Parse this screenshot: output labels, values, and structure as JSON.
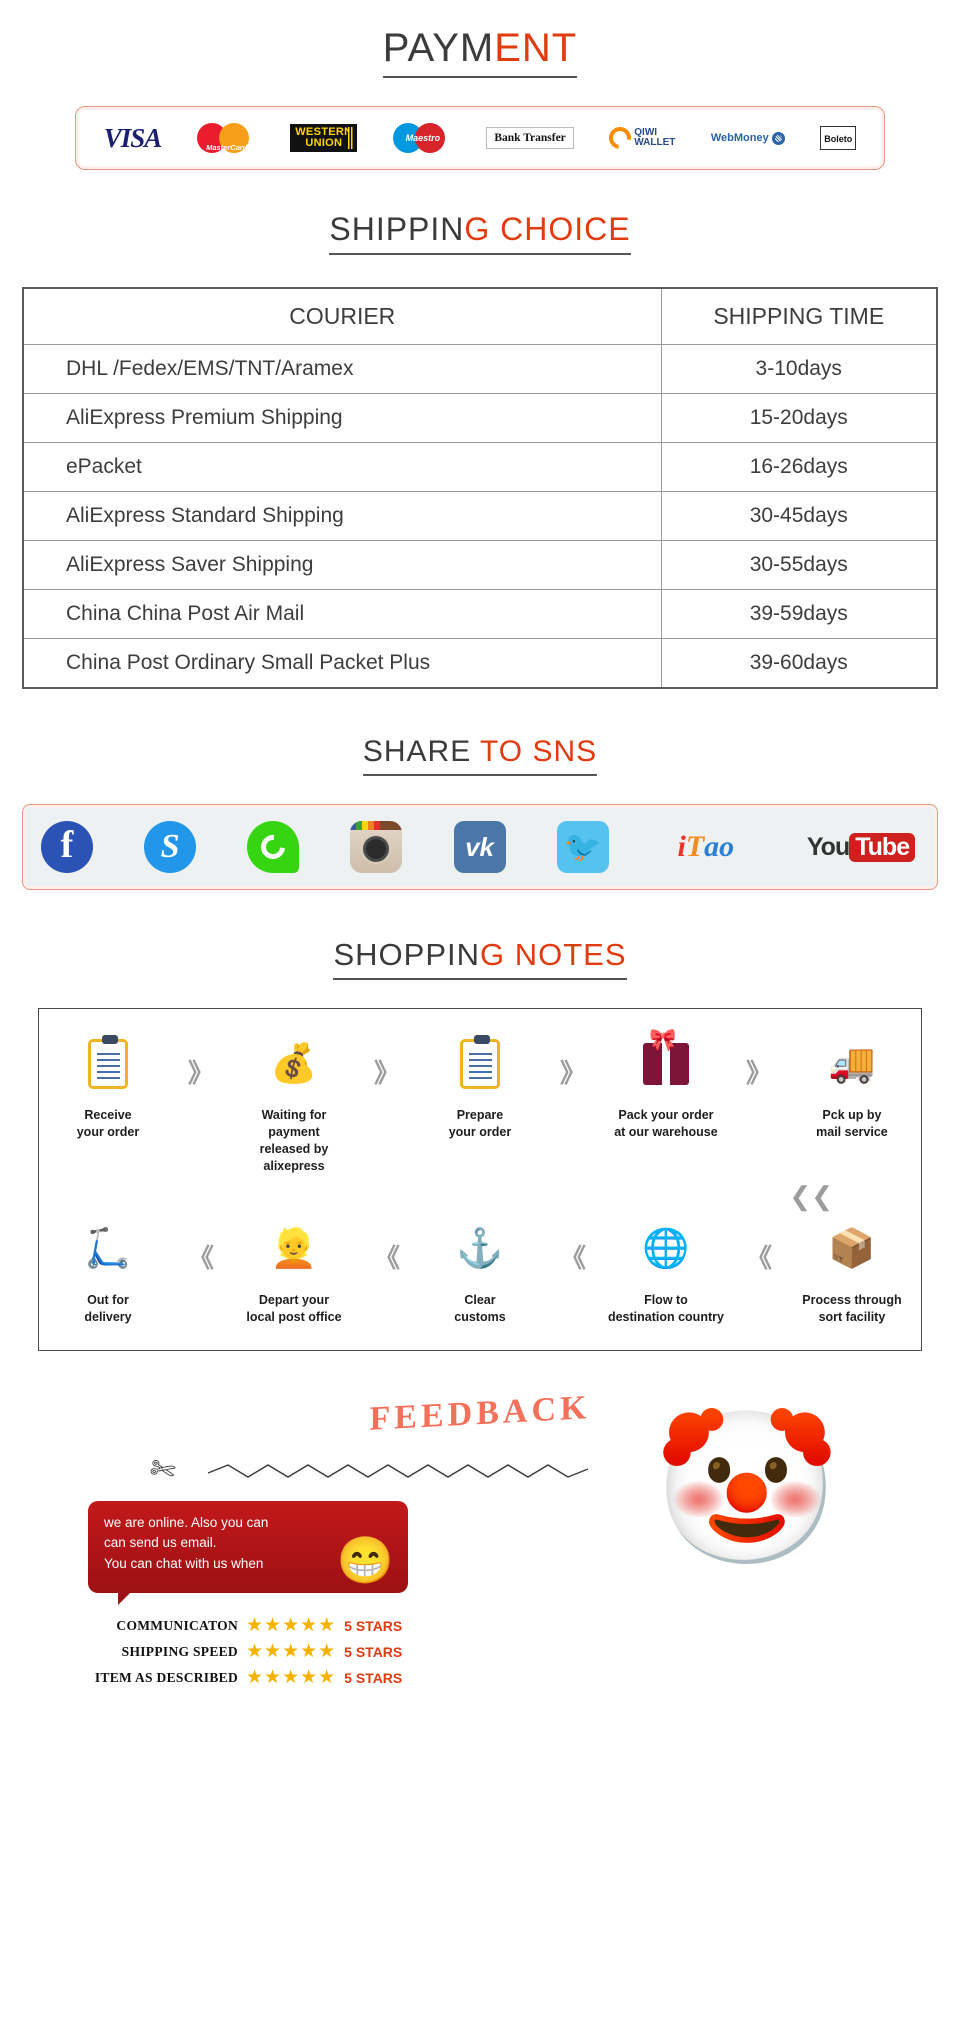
{
  "payment": {
    "title_dark": "PAYM",
    "title_red": "ENT",
    "methods": [
      {
        "name": "visa-logo",
        "label": "VISA"
      },
      {
        "name": "mastercard-logo",
        "label": "MasterCard"
      },
      {
        "name": "western-union-logo",
        "label_top": "WESTERN",
        "label_bottom": "UNION"
      },
      {
        "name": "maestro-logo",
        "label": "Maestro"
      },
      {
        "name": "bank-transfer-logo",
        "label": "Bank Transfer"
      },
      {
        "name": "qiwi-wallet-logo",
        "label_top": "QIWI",
        "label_bottom": "WALLET"
      },
      {
        "name": "webmoney-logo",
        "label": "WebMoney"
      },
      {
        "name": "boleto-logo",
        "label": "Boleto"
      }
    ]
  },
  "shipping": {
    "title_dark": "SHIPPIN",
    "title_red": "G CHOICE",
    "columns": [
      "COURIER",
      "SHIPPING TIME"
    ],
    "rows": [
      {
        "courier": "DHL /Fedex/EMS/TNT/Aramex",
        "time": "3-10days"
      },
      {
        "courier": "AliExpress Premium Shipping",
        "time": "15-20days"
      },
      {
        "courier": "ePacket",
        "time": "16-26days"
      },
      {
        "courier": "AliExpress Standard Shipping",
        "time": "30-45days"
      },
      {
        "courier": "AliExpress Saver Shipping",
        "time": "30-55days"
      },
      {
        "courier": "China China Post Air Mail",
        "time": "39-59days"
      },
      {
        "courier": "China Post Ordinary Small Packet Plus",
        "time": "39-60days"
      }
    ]
  },
  "sns": {
    "title_dark": "SHARE ",
    "title_red": "TO SNS",
    "networks": [
      {
        "name": "facebook-icon",
        "label": "f"
      },
      {
        "name": "skype-icon",
        "label": "S"
      },
      {
        "name": "whatsapp-icon",
        "label": "WhatsApp"
      },
      {
        "name": "instagram-icon",
        "label": "Instagram"
      },
      {
        "name": "vk-icon",
        "label": "vk"
      },
      {
        "name": "twitter-icon",
        "label": "✆"
      },
      {
        "name": "itao-icon",
        "label_i": "i",
        "label_t": "T",
        "label_ao": "ao"
      },
      {
        "name": "youtube-icon",
        "label_you": "You",
        "label_tube": "Tube"
      }
    ]
  },
  "notes": {
    "title_dark": "SHOPPIN",
    "title_red": "G NOTES",
    "row1": [
      {
        "icon": "clipboard-icon",
        "line1": "Receive",
        "line2": "your order"
      },
      {
        "icon": "money-bag-icon",
        "line1": "Waiting for payment",
        "line2": "released by alixepress"
      },
      {
        "icon": "clipboard-icon",
        "line1": "Prepare",
        "line2": "your order"
      },
      {
        "icon": "gift-box-icon",
        "line1": "Pack your order",
        "line2": "at our warehouse"
      },
      {
        "icon": "delivery-truck-icon",
        "line1": "Pck up by",
        "line2": "mail service"
      }
    ],
    "row2": [
      {
        "icon": "scooter-icon",
        "line1": "Out for",
        "line2": "delivery"
      },
      {
        "icon": "postman-icon",
        "line1": "Depart your",
        "line2": "local post office"
      },
      {
        "icon": "anchor-icon",
        "line1": "Clear",
        "line2": "customs"
      },
      {
        "icon": "globe-icon",
        "line1": "Flow to",
        "line2": "destination country"
      },
      {
        "icon": "parcel-cart-icon",
        "line1": "Process through",
        "line2": "sort facility"
      }
    ],
    "arrow_right": "》",
    "arrow_left": "《",
    "arrow_down": "⌄"
  },
  "feedback": {
    "title": "FEEDBACK",
    "chat_lines": [
      "we are online. Also you can",
      "can send us email.",
      "You can chat with us when"
    ],
    "ratings": [
      {
        "label": "COMMUNICATON",
        "stars": "★★★★★",
        "text": "5 STARS"
      },
      {
        "label": "SHIPPING SPEED",
        "stars": "★★★★★",
        "text": "5 STARS"
      },
      {
        "label": "ITEM AS DESCRIBED",
        "stars": "★★★★★",
        "text": "5 STARS"
      }
    ]
  },
  "colors": {
    "accent_red": "#e13b10",
    "dark": "#3b3b3b",
    "border_peach": "#e9977e"
  }
}
